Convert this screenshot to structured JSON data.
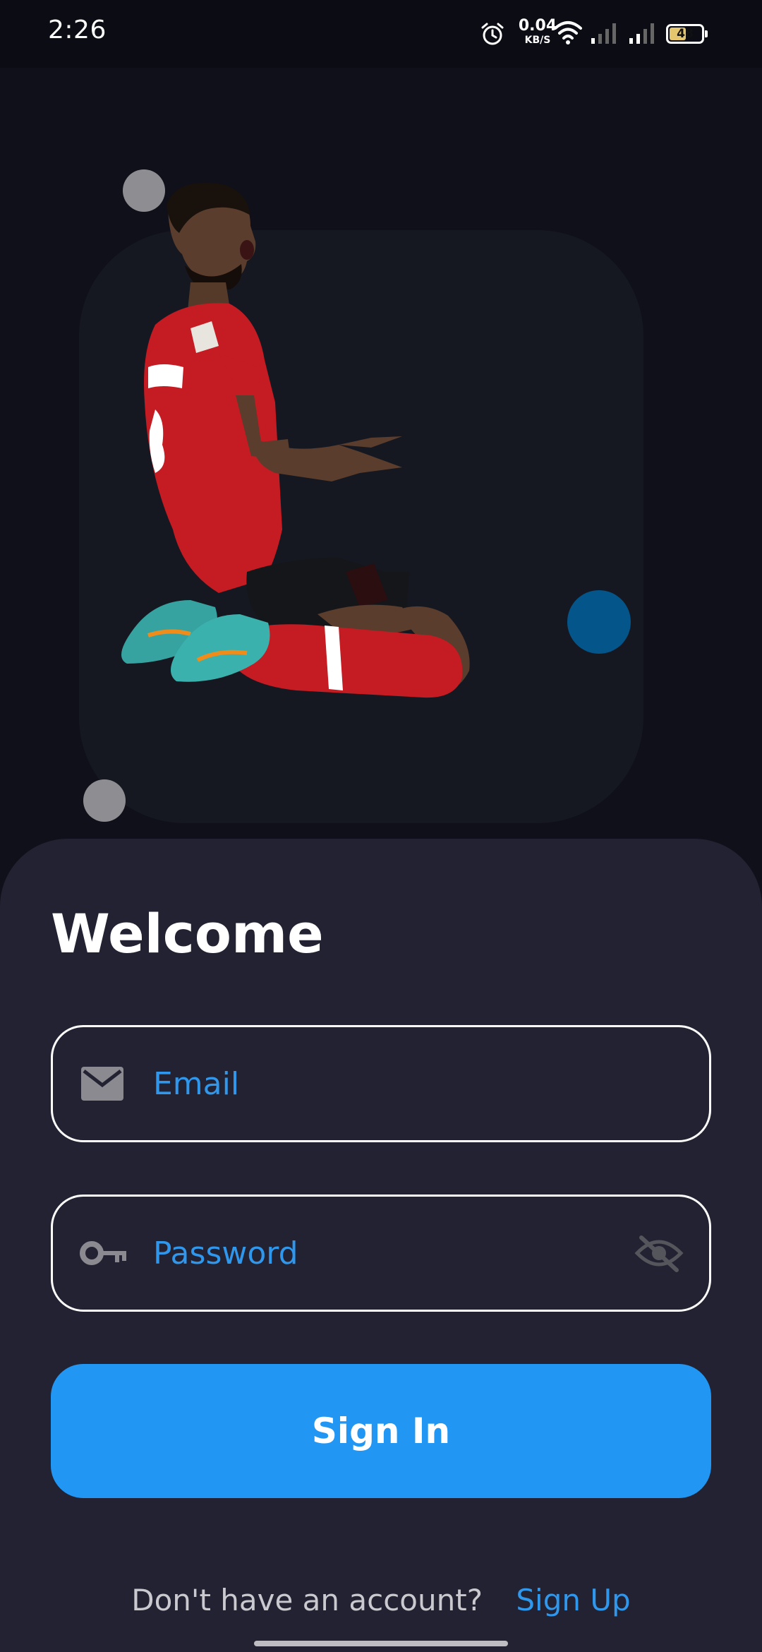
{
  "status_bar": {
    "time": "2:26",
    "net_speed_value": "0.04",
    "net_speed_unit": "KB/S",
    "battery": "48",
    "icons": [
      "alarm-icon",
      "wifi-icon",
      "signal-icon",
      "signal-icon",
      "battery-icon"
    ]
  },
  "hero": {
    "image": "footballer-celebrating-knee-slide",
    "colors": {
      "panel": "#161821",
      "accent_dot": "#04558a",
      "grey_dot": "#8e8e92"
    }
  },
  "login": {
    "title": "Welcome",
    "email": {
      "placeholder": "Email",
      "value": "",
      "icon": "mail-icon"
    },
    "password": {
      "placeholder": "Password",
      "value": "",
      "icon": "key-icon",
      "toggle_icon": "eye-off-icon"
    },
    "sign_in_label": "Sign In",
    "signup_prompt": "Don't have an account?",
    "signup_link": "Sign Up"
  },
  "colors": {
    "background": "#0f101a",
    "sheet": "#222232",
    "primary": "#2196f3",
    "link": "#2f97ec"
  }
}
